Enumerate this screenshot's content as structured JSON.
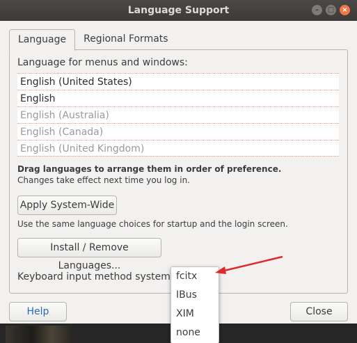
{
  "window": {
    "title": "Language Support",
    "controls": [
      "minimize-icon",
      "maximize-icon",
      "close-icon"
    ]
  },
  "tabs": [
    {
      "label": "Language",
      "active": true
    },
    {
      "label": "Regional Formats",
      "active": false
    }
  ],
  "language": {
    "heading": "Language for menus and windows:",
    "items": [
      {
        "label": "English (United States)",
        "dim": false
      },
      {
        "label": "English",
        "dim": false
      },
      {
        "label": "English (Australia)",
        "dim": true
      },
      {
        "label": "English (Canada)",
        "dim": true
      },
      {
        "label": "English (United Kingdom)",
        "dim": true
      }
    ],
    "hint_bold": "Drag languages to arrange them in order of preference.",
    "hint": "Changes take effect next time you log in.",
    "apply_button": "Apply System-Wide",
    "apply_note": "Use the same language choices for startup and the login screen.",
    "install_button": "Install / Remove Languages...",
    "keyboard_label": "Keyboard input method system:"
  },
  "dropdown": {
    "options": [
      "fcitx",
      "IBus",
      "XIM",
      "none"
    ]
  },
  "footer": {
    "help_button": "Help",
    "close_button": "Close"
  },
  "colors": {
    "accent_arrow": "#e02a2a",
    "close_control": "#f07746",
    "help_text": "#2a6bb5"
  }
}
